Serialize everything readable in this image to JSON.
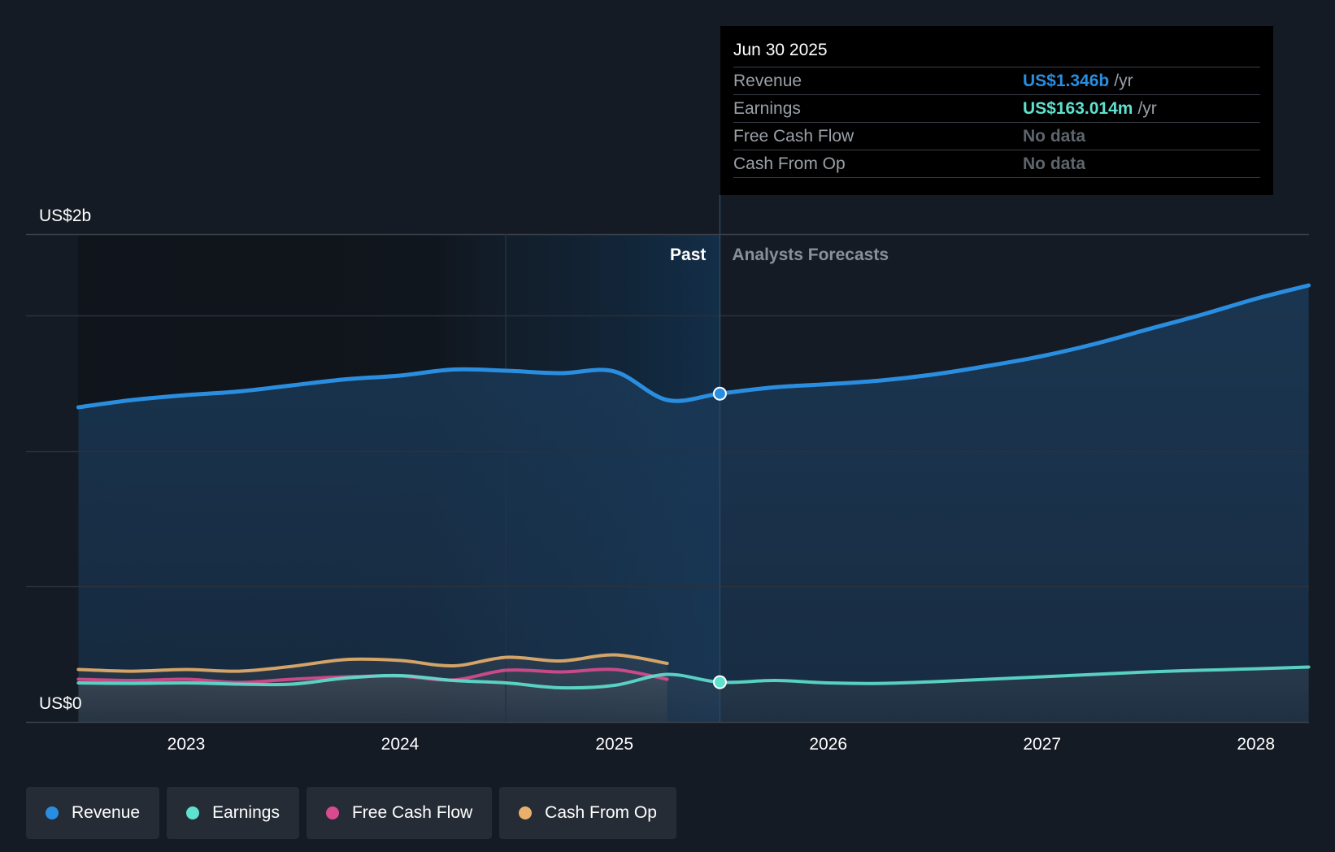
{
  "chart_data": {
    "type": "line",
    "y_axis": {
      "labels": [
        "US$2b",
        "US$0"
      ],
      "ylim": [
        0,
        2000
      ],
      "unit": "US$m"
    },
    "x_axis": {
      "ticks": [
        "2023",
        "2024",
        "2025",
        "2026",
        "2027",
        "2028"
      ]
    },
    "regions": {
      "past_label": "Past",
      "forecast_label": "Analysts Forecasts",
      "divider": "Jun 30 2025"
    },
    "series": [
      {
        "name": "Revenue",
        "color": "#2a8ee0",
        "points": [
          [
            "2022-07-01",
            1290
          ],
          [
            "2022-10-01",
            1320
          ],
          [
            "2023-01-01",
            1340
          ],
          [
            "2023-04-01",
            1355
          ],
          [
            "2023-07-01",
            1380
          ],
          [
            "2023-10-01",
            1405
          ],
          [
            "2024-01-01",
            1420
          ],
          [
            "2024-04-01",
            1445
          ],
          [
            "2024-07-01",
            1440
          ],
          [
            "2024-10-01",
            1430
          ],
          [
            "2025-01-01",
            1437
          ],
          [
            "2025-04-01",
            1320
          ],
          [
            "2025-06-30",
            1346
          ],
          [
            "2025-10-01",
            1372
          ],
          [
            "2026-01-01",
            1385
          ],
          [
            "2026-04-01",
            1400
          ],
          [
            "2026-07-01",
            1425
          ],
          [
            "2026-10-01",
            1460
          ],
          [
            "2027-01-01",
            1500
          ],
          [
            "2027-04-01",
            1550
          ],
          [
            "2027-07-01",
            1610
          ],
          [
            "2027-10-01",
            1670
          ],
          [
            "2028-01-01",
            1735
          ],
          [
            "2028-03-31",
            1790
          ]
        ]
      },
      {
        "name": "Earnings",
        "color": "#5ee1cf",
        "points": [
          [
            "2022-07-01",
            160
          ],
          [
            "2022-10-01",
            158
          ],
          [
            "2023-01-01",
            160
          ],
          [
            "2023-04-01",
            155
          ],
          [
            "2023-07-01",
            155
          ],
          [
            "2023-10-01",
            180
          ],
          [
            "2024-01-01",
            190
          ],
          [
            "2024-04-01",
            170
          ],
          [
            "2024-07-01",
            160
          ],
          [
            "2024-10-01",
            140
          ],
          [
            "2025-01-01",
            150
          ],
          [
            "2025-04-01",
            195
          ],
          [
            "2025-06-30",
            163
          ],
          [
            "2025-10-01",
            170
          ],
          [
            "2026-01-01",
            160
          ],
          [
            "2026-04-01",
            158
          ],
          [
            "2026-07-01",
            165
          ],
          [
            "2026-10-01",
            175
          ],
          [
            "2027-01-01",
            185
          ],
          [
            "2027-04-01",
            195
          ],
          [
            "2027-07-01",
            205
          ],
          [
            "2027-10-01",
            212
          ],
          [
            "2028-01-01",
            218
          ],
          [
            "2028-03-31",
            225
          ]
        ]
      },
      {
        "name": "Free Cash Flow",
        "color": "#d94b8f",
        "points": [
          [
            "2022-07-01",
            175
          ],
          [
            "2022-10-01",
            170
          ],
          [
            "2023-01-01",
            175
          ],
          [
            "2023-04-01",
            162
          ],
          [
            "2023-07-01",
            175
          ],
          [
            "2023-10-01",
            185
          ],
          [
            "2024-01-01",
            188
          ],
          [
            "2024-04-01",
            172
          ],
          [
            "2024-07-01",
            212
          ],
          [
            "2024-10-01",
            205
          ],
          [
            "2025-01-01",
            215
          ],
          [
            "2025-04-01",
            175
          ]
        ]
      },
      {
        "name": "Cash From Op",
        "color": "#e8b06b",
        "points": [
          [
            "2022-07-01",
            215
          ],
          [
            "2022-10-01",
            208
          ],
          [
            "2023-01-01",
            215
          ],
          [
            "2023-04-01",
            208
          ],
          [
            "2023-07-01",
            228
          ],
          [
            "2023-10-01",
            256
          ],
          [
            "2024-01-01",
            252
          ],
          [
            "2024-04-01",
            230
          ],
          [
            "2024-07-01",
            265
          ],
          [
            "2024-10-01",
            250
          ],
          [
            "2025-01-01",
            275
          ],
          [
            "2025-04-01",
            240
          ]
        ]
      }
    ]
  },
  "tooltip": {
    "date": "Jun 30 2025",
    "rows": [
      {
        "label": "Revenue",
        "value": "US$1.346b",
        "unit": "/yr",
        "color": "#2a8ee0"
      },
      {
        "label": "Earnings",
        "value": "US$163.014m",
        "unit": "/yr",
        "color": "#5ee1cf"
      },
      {
        "label": "Free Cash Flow",
        "value": "No data",
        "unit": "",
        "color": "#5f656d"
      },
      {
        "label": "Cash From Op",
        "value": "No data",
        "unit": "",
        "color": "#5f656d"
      }
    ]
  },
  "legend": [
    {
      "label": "Revenue",
      "color": "#2a8ee0"
    },
    {
      "label": "Earnings",
      "color": "#5ee1cf"
    },
    {
      "label": "Free Cash Flow",
      "color": "#d94b8f"
    },
    {
      "label": "Cash From Op",
      "color": "#e8b06b"
    }
  ]
}
